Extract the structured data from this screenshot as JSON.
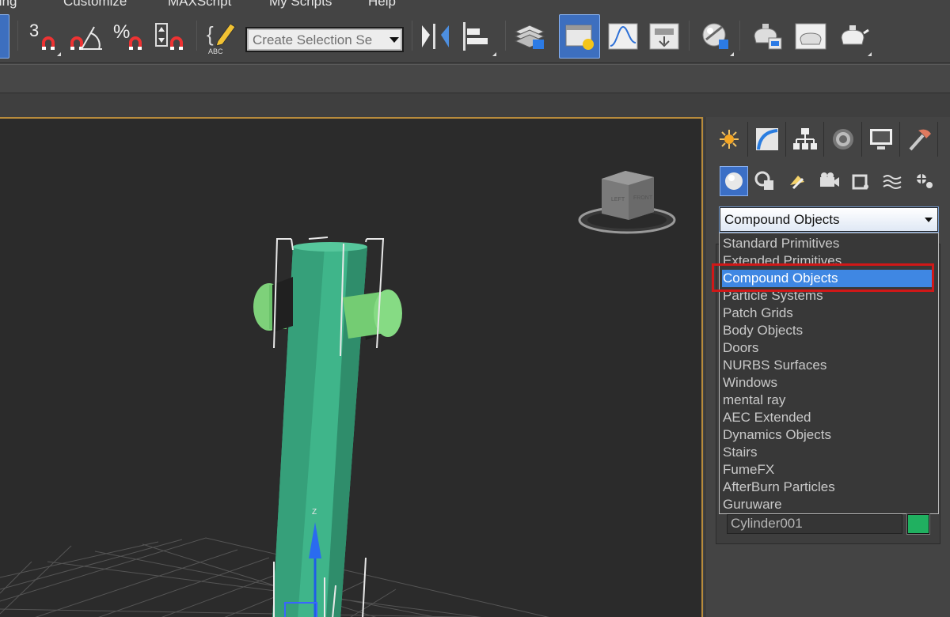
{
  "menu": {
    "items": [
      "ting",
      "Customize",
      "MAXScript",
      "My Scripts",
      "Help"
    ]
  },
  "toolbar": {
    "selection_set_placeholder": "Create Selection Se",
    "angle_snap_glyph": "3",
    "percent_snap_glyph": "%",
    "edit_named_sets_glyph": "{",
    "abc_glyph": "ABC",
    "icons": [
      "snaps-toggle-icon",
      "angle-snap-icon",
      "percent-snap-icon",
      "spinner-snap-icon",
      "edit-named-selection-icon",
      "mirror-icon",
      "align-icon",
      "layer-manager-icon",
      "scene-explorer-icon",
      "curve-editor-icon",
      "schematic-view-icon",
      "material-editor-icon",
      "render-setup-icon",
      "rendered-frame-icon",
      "render-production-icon"
    ]
  },
  "viewport": {
    "viewcube_labels": [
      "LEFT",
      "FRONT"
    ],
    "gizmo_axis_label": "Z",
    "object_color": "#3fb58a"
  },
  "command_panel": {
    "tabs": [
      "create-tab",
      "modify-tab",
      "hierarchy-tab",
      "motion-tab",
      "display-tab",
      "utilities-tab"
    ],
    "create_subtypes": [
      "geometry",
      "shapes",
      "lights",
      "cameras",
      "helpers",
      "space-warps",
      "systems"
    ],
    "category_value": "Compound Objects",
    "category_options": [
      "Standard Primitives",
      "Extended Primitives",
      "Compound Objects",
      "Particle Systems",
      "Patch Grids",
      "Body Objects",
      "Doors",
      "NURBS Surfaces",
      "Windows",
      "mental ray",
      "AEC Extended",
      "Dynamics Objects",
      "Stairs",
      "FumeFX",
      "AfterBurn Particles",
      "Guruware"
    ],
    "selected_option": "Compound Objects",
    "object_name": "Cylinder001",
    "object_color": "#20b060"
  },
  "colors": {
    "accent_blue": "#3f87e3",
    "highlight_red": "#d01818",
    "viewport_border": "#b88b3c"
  }
}
